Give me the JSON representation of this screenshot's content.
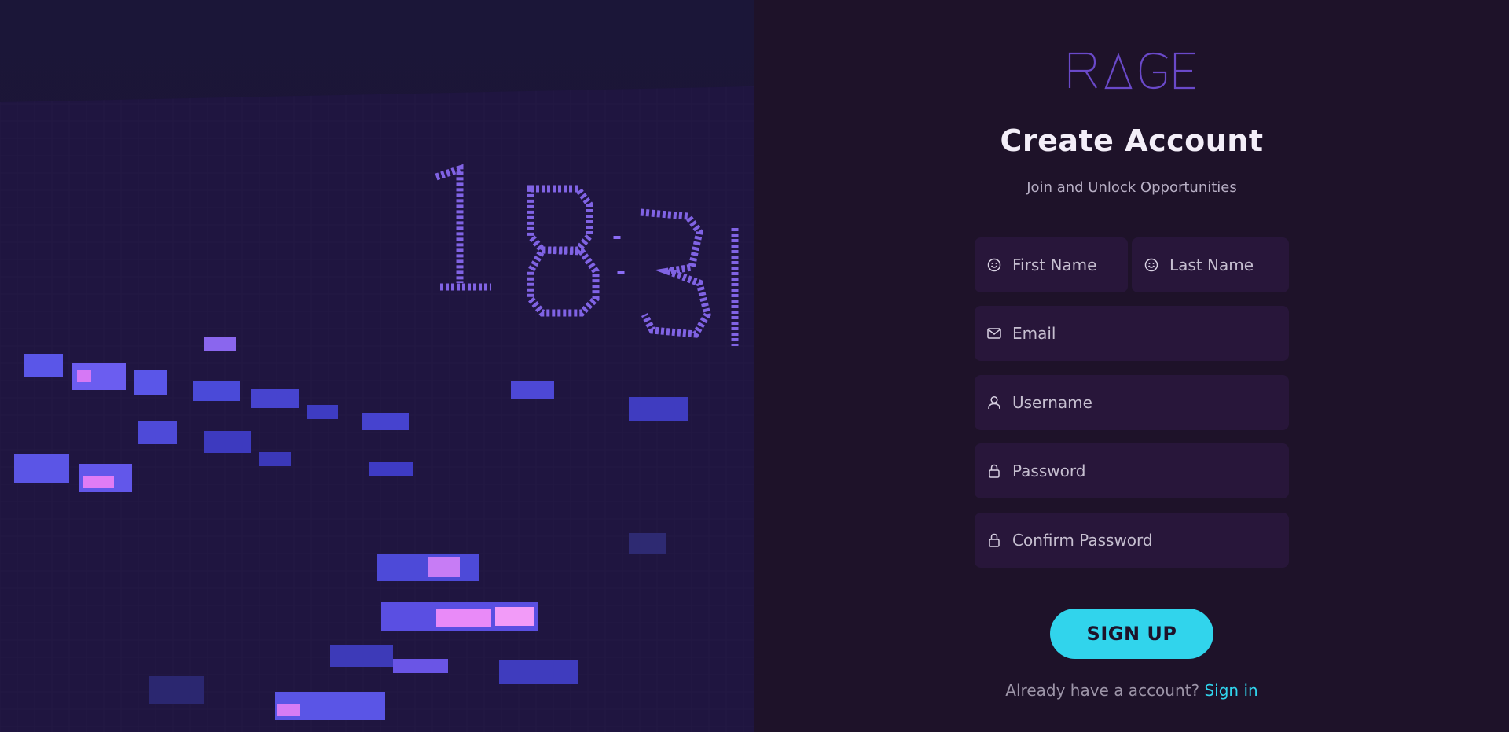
{
  "brand": {
    "logo_text": "RAGE"
  },
  "hero": {
    "sign_text": "18:31"
  },
  "form": {
    "title": "Create Account",
    "subtitle": "Join and Unlock Opportunities",
    "fields": {
      "first_name": {
        "placeholder": "First Name",
        "icon": "smiley-icon"
      },
      "last_name": {
        "placeholder": "Last Name",
        "icon": "smiley-icon"
      },
      "email": {
        "placeholder": "Email",
        "icon": "envelope-icon"
      },
      "username": {
        "placeholder": "Username",
        "icon": "user-icon"
      },
      "password": {
        "placeholder": "Password",
        "icon": "lock-icon"
      },
      "confirm_password": {
        "placeholder": "Confirm Password",
        "icon": "lock-icon"
      }
    },
    "submit_label": "SIGN UP",
    "signin_prompt": "Already have a account?",
    "signin_link": "Sign in"
  },
  "colors": {
    "background": "#1e1229",
    "field_bg": "#28163a",
    "accent": "#31d4ec",
    "logo": "#6a49c9"
  }
}
